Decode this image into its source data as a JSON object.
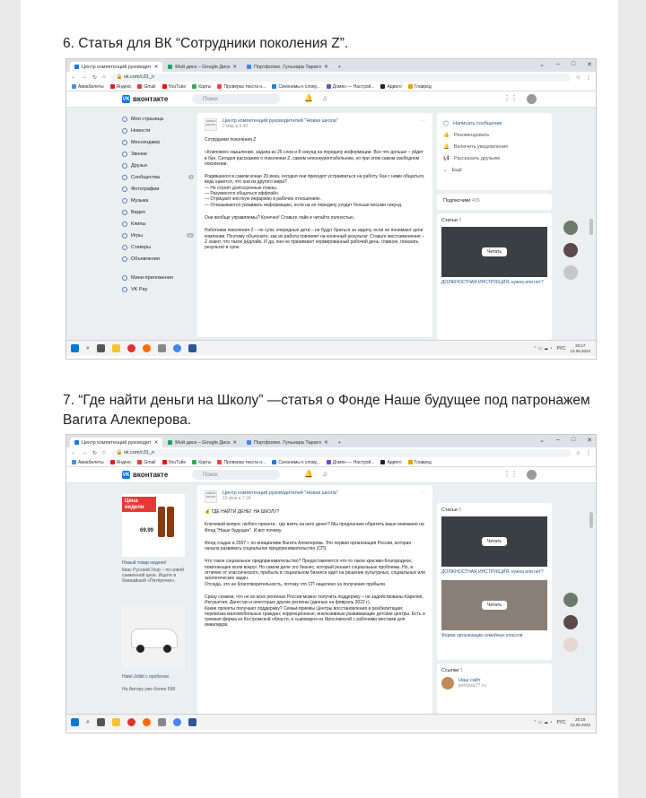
{
  "section1": {
    "heading": "6. Статья для ВК “Сотрудники поколения Z”."
  },
  "section2": {
    "heading": "7. “Где найти деньги на Школу” —статья о Фонде Наше будущее под патронажем Вагита Алекперова."
  },
  "browser": {
    "tabs": [
      "Центр компетенций руководит",
      "Мой диск – Google Диск",
      "Портфолио. Гульнара Тарато"
    ],
    "url": "vk.com/c31_n",
    "bookmarks": [
      "Авиабилеты",
      "Яндекс",
      "Gmail",
      "YouTube",
      "Карты",
      "Проверка текста н...",
      "Синонимы к слову...",
      "Домен — Настрой...",
      "Адвего",
      "Главред"
    ]
  },
  "vk": {
    "logo": "вконтакте",
    "search_placeholder": "Поиск",
    "menu": [
      "Моя страница",
      "Новости",
      "Мессенджер",
      "Звонки",
      "Друзья",
      "Сообщества",
      "Фотографии",
      "Музыка",
      "Видео",
      "Клипы",
      "Игры",
      "Стикеры",
      "Объявления",
      "Мини-приложения",
      "VK Pay"
    ],
    "counts": {
      "communities": "3",
      "games": "11"
    }
  },
  "post1": {
    "community": "Центр компетенций руководителей \"Новая школа\"",
    "date": "2 мар в 6:40",
    "paragraphs": [
      "Сотрудники поколения Z",
      "«Клиповое» мышление, задача из 25 слов и 8 секунд на передачу информации. Все что дольше – уйдет в бан. Сегодня расскажем о поколении Z, самом неконкурентабельном, но при этом самом свободном поколении.",
      "Родившиеся в самом конце 20 века, сегодня они приходят устраиваться на работу. Как с ними общаться, ведь кажется, что они из другого мира?\n— Не строят долгосрочные планы.\n— Разумеются общаться оффлайн.\n— Отрицают жесткую иерархию в рабочих отношениях.\n— Отказываются усваивать информацию, если на ее передачу уходит больше восьми секунд.",
      "Они вообще управляемы? Конечно! Ставьте лайк и читайте полностью.",
      "Работники поколения Z – по сути, очередные дети – не будут браться за задачу, если не понимают цели компании. Поэтому объясните, как их работа повлияет на конечный результат. Ставьте местоименения – Z знают, что такое дедлайн. И да, они не принимают нормированный рабочий день: главное, показать результат в срок."
    ]
  },
  "right1": {
    "actions": [
      "Написать сообщение",
      "Рекомендовать",
      "Включить уведомления",
      "Расcказать друзьям",
      "Ещё"
    ],
    "subscribers_label": "Подписчики",
    "subscribers_count": "485",
    "articles_label": "Статьи",
    "articles_count": "5",
    "read": "Читать",
    "caption": "ДОЛЖНОСТНАЯ ИНСТРУКЦИЯ, нужна или нет?"
  },
  "post2": {
    "community": "Центр компетенций руководителей \"Новая школа\"",
    "date": "10 фев в 7:24",
    "paragraphs": [
      "ГДЕ НАЙТИ ДЕНЕГ НА ШКОЛУ?",
      "Ключевой вопрос любого проекта - где взять на него денег? Мы предлагаем обратить ваше внимание на Фонд \"Наше будущее\". И вот почему.",
      "Фонд создан в 2007 г. по инициативе Вагита Алекперова. Это первая организация России, которая начала развивать социальное предпринимательство (СП).",
      "Что такое социальное предпринимательство? Предоставляется что-то такое красиво-благородное, помогающее всем вокруг. Но самом деле это бизнес, который решает социальные проблемы. Но, в отличие от классического, прибыль в социальном бизнесе идет на решение культурных, социальных или экологических задач.\nОтсюда, это не благотворительность, потому что СП нацелено на получение прибыли.",
      "Сразу скажем, что не во всех регионах России можно получить поддержку – не задействованы Карелия, Ингушетия, Дагестан и некоторые другие регионы (данные на февраль 2022 г).\nКакие проекты получают поддержку? Семьи-приемы Центры восстановления и реабилитации; перевозка маломобильных граждан; коррекционные, инклюзивные развивающие детские центры. Есть и громкая фирма из Костромской области, и сыроварня из Ярославской с рабочими местами для инвалидов."
    ]
  },
  "ads": {
    "price_badge": "Цена недели",
    "price": "69.99",
    "ad1_title": "Новый товар недели!",
    "ad1_sub": "Квас Русский Узор – по новой сниженной цене. Ищите в ближайшей «Пятёрочке».",
    "ad2_title": "Hatel Jolbit с пробегом",
    "ad2_sub": "На Автору уже более 598"
  },
  "right2": {
    "articles_label": "Статьи",
    "articles_count": "5",
    "read": "Читать",
    "caption1": "ДОЛЖНОСТНАЯ ИНСТРУКЦИЯ, нужна или нет?",
    "caption2": "Форма организации семейных классов",
    "contacts_label": "Ссылки",
    "contacts_count": "1",
    "contact_name": "Наш сайт",
    "contact_url": "petrova77.ru"
  },
  "taskbar": {
    "lang": "РУС",
    "time1": "20:17",
    "date1": "13.06.2022",
    "time2": "20:19",
    "date2": "13.06.2022"
  }
}
